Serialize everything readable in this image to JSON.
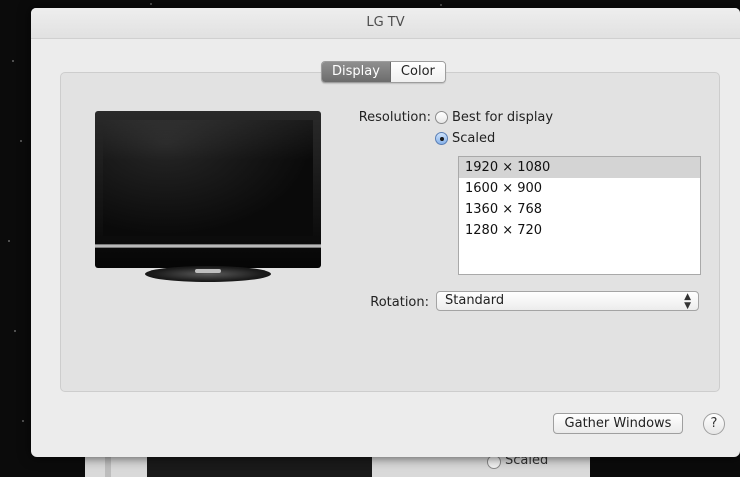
{
  "window": {
    "title": "LG TV"
  },
  "tabs": [
    {
      "label": "Display",
      "active": true
    },
    {
      "label": "Color",
      "active": false
    }
  ],
  "resolution": {
    "label": "Resolution:",
    "options": [
      {
        "label": "Best for display",
        "checked": false
      },
      {
        "label": "Scaled",
        "checked": true
      }
    ],
    "list": [
      "1920 × 1080",
      "1600 × 900",
      "1360 × 768",
      "1280 × 720"
    ],
    "selected": "1920 × 1080"
  },
  "rotation": {
    "label": "Rotation:",
    "value": "Standard"
  },
  "footer": {
    "gather_label": "Gather Windows",
    "help_label": "?"
  },
  "background_window": {
    "radio_label": "Scaled"
  },
  "colors": {
    "accent": "#86b2ea",
    "tab_active": "#7a7a7a",
    "selection": "#d4d4d4"
  }
}
